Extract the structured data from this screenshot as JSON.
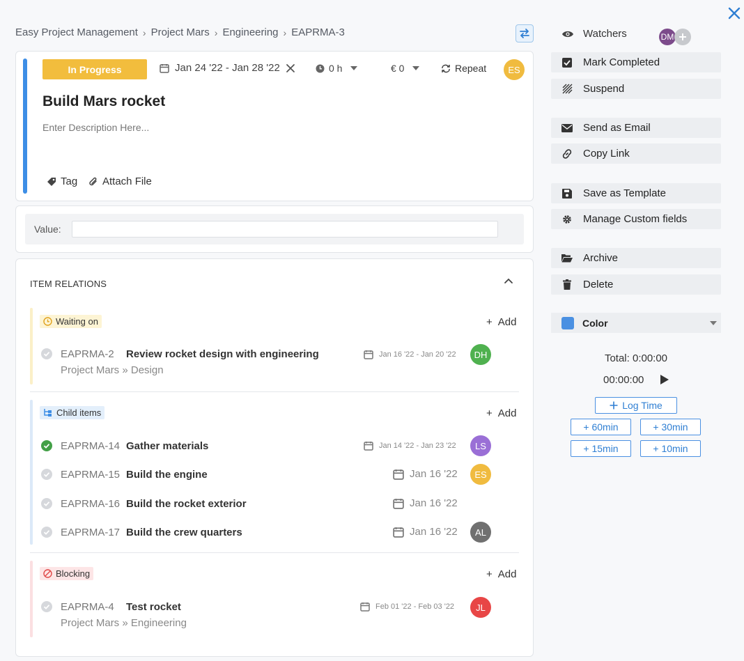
{
  "breadcrumb": [
    "Easy Project Management",
    "Project Mars",
    "Engineering",
    "EAPRMA-3"
  ],
  "task": {
    "status": "In Progress",
    "date_range": "Jan 24 '22 - Jan 28 '22",
    "hours": "0 h",
    "cost": "€ 0",
    "repeat_label": "Repeat",
    "assignee_initials": "ES",
    "title": "Build Mars rocket",
    "description_placeholder": "Enter Description Here...",
    "tag_label": "Tag",
    "attach_label": "Attach File"
  },
  "custom_field": {
    "label": "Value:",
    "value": ""
  },
  "relations": {
    "header": "ITEM RELATIONS",
    "add_label": "Add",
    "waiting": {
      "label": "Waiting on",
      "items": [
        {
          "id": "EAPRMA-2",
          "title": "Review rocket design with engineering",
          "subtitle": "Project Mars » Design",
          "date": "Jan 16 '22 - Jan 20 '22",
          "initials": "DH",
          "completed": false
        }
      ]
    },
    "children": {
      "label": "Child items",
      "items": [
        {
          "id": "EAPRMA-14",
          "title": "Gather materials",
          "date": "Jan 14 '22 - Jan 23 '22",
          "initials": "LS",
          "completed": true
        },
        {
          "id": "EAPRMA-15",
          "title": "Build the engine",
          "date": "Jan 16 '22",
          "initials": "ES",
          "completed": false
        },
        {
          "id": "EAPRMA-16",
          "title": "Build the rocket exterior",
          "date": "Jan 16 '22",
          "initials": "",
          "completed": false
        },
        {
          "id": "EAPRMA-17",
          "title": "Build the crew quarters",
          "date": "Jan 16 '22",
          "initials": "AL",
          "completed": false
        }
      ]
    },
    "blocking": {
      "label": "Blocking",
      "items": [
        {
          "id": "EAPRMA-4",
          "title": "Test rocket",
          "subtitle": "Project Mars » Engineering",
          "date": "Feb 01 '22 - Feb 03 '22",
          "initials": "JL",
          "completed": false
        }
      ]
    }
  },
  "sidebar": {
    "watchers_label": "Watchers",
    "watcher_initials": "DM",
    "actions": [
      "Mark Completed",
      "Suspend",
      "Send as Email",
      "Copy Link",
      "Save as Template",
      "Manage Custom fields",
      "Archive",
      "Delete"
    ],
    "color_label": "Color",
    "color_value": "#4a90e2",
    "total": "Total: 0:00:00",
    "timer": "00:00:00",
    "log_time": "Log Time",
    "quick_times": [
      "+ 60min",
      "+ 30min",
      "+ 15min",
      "+ 10min"
    ]
  },
  "colors": {
    "accent": "#3d8ee6",
    "status": "#f2bd3d",
    "avatar_es": "#f0bb3f",
    "avatar_dh": "#4fb14f",
    "avatar_ls": "#9a6fd6",
    "avatar_al": "#707070",
    "avatar_jl": "#e84646",
    "avatar_dm": "#7c4b8b"
  }
}
